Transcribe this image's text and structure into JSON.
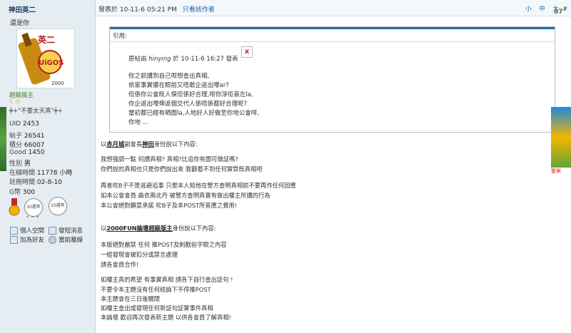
{
  "sidebar": {
    "username": "神田英二",
    "subtitle": "還是你",
    "avatar_text": "英二",
    "rank": "超級版主",
    "stars": "☾✩",
    "motto": "╪+\"不要太天真\"╪+",
    "stats": [
      {
        "label": "UID",
        "value": "2453"
      },
      {
        "label": "帖子",
        "value": "26541"
      },
      {
        "label": "積分",
        "value": "66007"
      },
      {
        "label": "Good",
        "value": "1450"
      },
      {
        "label": "性別",
        "value": "男"
      },
      {
        "label": "在線時間",
        "value": "11778 小時"
      },
      {
        "label": "註冊時間",
        "value": "02-8-10"
      },
      {
        "label": "G幣",
        "value": "300"
      }
    ],
    "badges": [
      "10週年",
      "10週年"
    ],
    "dots": "• • •",
    "actions": [
      {
        "label": "個人空間"
      },
      {
        "label": "發短消息"
      },
      {
        "label": "加為好友"
      },
      {
        "label": "當前離線"
      }
    ]
  },
  "post_header": {
    "meta": "發表於 10-11-6 05:21 PM",
    "only_author": "只看該作者",
    "font_sizes": "小 中 大",
    "floor": "87"
  },
  "quote": {
    "label": "引用:",
    "source_prefix": "原帖由",
    "source_user": "hinying",
    "source_suffix": "於 10-11-6 16:27 發表",
    "close": "x",
    "lines": [
      "你之前講到自己咁想查出真相,",
      "依家事實擺在眼前又唔敢企返出嚟ar?",
      "佢係你公會既人保佢係好合理,咁你淨佢衰左la,",
      "你企返出嚟俾返個交代人係唔係都好合理呢?",
      "當初都已經有晒圖la,人地好人好做至你地公會咩,",
      "你地 ..."
    ]
  },
  "body": {
    "sec1_prefix": "以",
    "sec1_guild": "赤月城",
    "sec1_role": "副會長",
    "sec1_name": "神田",
    "sec1_suffix": "身份說以下內容:",
    "p1": [
      "我想強調一點 何謂真相? 真相?比追你有圖可做証嗎?",
      "你們說的真相也只是你們說出來 我觀看不到任何實質既真相吧"
    ],
    "p2": [
      "再者吹B子不是逃避追事 只是本人知他在警方查明真相前不要再作任何回應",
      "如本公會會員 曲衣南北丹 被警方查明真實有做出樓主所講的行為",
      "本公會絕對願意承諾 吹B子及本POST所答應之費用!"
    ],
    "sec2_prefix": "以",
    "sec2_name": "2000FUN論壇超級版主",
    "sec2_suffix": "身份說以下內容:",
    "p3": [
      "本版絕對嚴禁 任何 推POST及刺戳俗字眼之內容",
      "一經發現會被扣分或禁言處理",
      "請各會員合作!"
    ],
    "p4": [
      "如樓主真的希望 有事實真相 請各下自行查出証句 !",
      "不要令本主題沒有任何結論下不停推POST",
      "本主題會在三日後關閉",
      "如樓主查出或發現任何新証句証實事件真相",
      "本論壇 歡迎再次發表新主題 以供各會員了解真相!"
    ]
  },
  "side_ads": {
    "right_label": "警察"
  }
}
